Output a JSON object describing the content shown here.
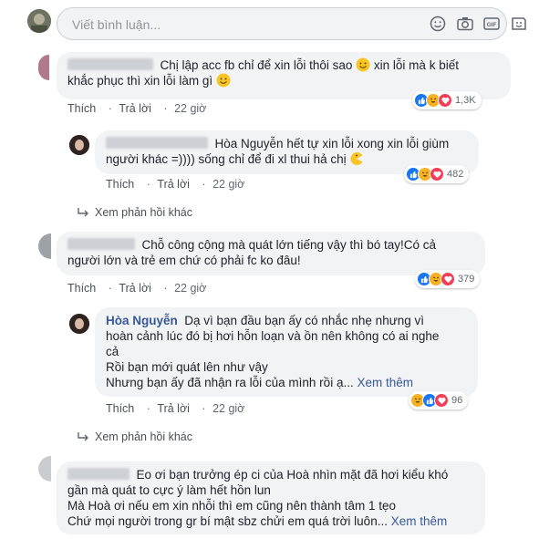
{
  "composer": {
    "placeholder": "Viết bình luận..."
  },
  "comments": [
    {
      "author": "",
      "text_line1": "Chị lập acc fb chỉ để xin lỗi thôi sao",
      "text_line1b": "xin lỗi mà k biết",
      "text_line2": "khắc phục thì xin lỗi làm gì",
      "like_label": "Thích",
      "reply_label": "Trả lời",
      "time": "22 giờ",
      "reaction_count": "1,3K",
      "reply": {
        "author": "Hòa Nguyễn",
        "text_line1": "Hòa Nguyễn hết tự xin lỗi xong xin lỗi giùm",
        "text_line2": "người khác =)))) sống chỉ để đi xl thui hả chị",
        "like_label": "Thích",
        "reply_label": "Trả lời",
        "time": "22 giờ",
        "reaction_count": "482"
      },
      "more_replies": "Xem phản hồi khác"
    },
    {
      "author": "",
      "text_line1": "Chỗ công cộng mà quát lớn tiếng vậy thì bó tay!Có cả",
      "text_line2": "người lớn và trẻ em chứ có phải fc ko đâu!",
      "like_label": "Thích",
      "reply_label": "Trả lời",
      "time": "22 giờ",
      "reaction_count": "379",
      "reply": {
        "author": "Hòa Nguyễn",
        "text_line1": "Dạ vì bạn đầu bạn ấy có nhắc nhẹ nhưng vì",
        "text_line2": "hoàn cảnh lúc đó bị hơi hỗn loạn và ồn nên không có ai nghe",
        "text_line3": "cả",
        "text_line4": "Rồi bạn mới quát lên như vậy",
        "text_line5": "Nhưng bạn ấy đã nhận ra lỗi của mình rồi ạ...",
        "see_more": "Xem thêm",
        "like_label": "Thích",
        "reply_label": "Trả lời",
        "time": "22 giờ",
        "reaction_count": "96"
      },
      "more_replies": "Xem phản hồi khác"
    },
    {
      "author": "",
      "text_line1": "Eo ơi bạn trưởng ép ci của Hoà nhìn mặt đã hơi kiểu khó",
      "text_line2": "gần mà quát to cực ý làm hết hồn lun",
      "text_line3": "Mà Hoà ơi nếu em xin nhỗi thì em cũng nên thành tâm 1 tẹo",
      "text_line4": "Chứ mọi người trong gr bí mật sbz chửi em quá trời luôn...",
      "see_more": "Xem thêm"
    }
  ],
  "colors": {
    "like": "#1877f2",
    "haha": "#f7b125",
    "love": "#f33e58",
    "link": "#385898"
  }
}
